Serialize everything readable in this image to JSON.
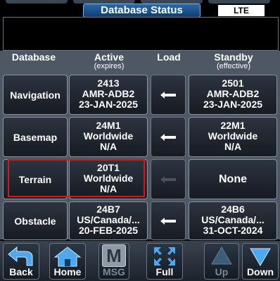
{
  "header": {
    "title": "Database Status",
    "connection": "LTE"
  },
  "columns": {
    "database": "Database",
    "active": "Active",
    "active_sub": "(expires)",
    "load": "Load",
    "standby": "Standby",
    "standby_sub": "(effective)"
  },
  "rows": [
    {
      "name": "Navigation",
      "active": [
        "2413",
        "AMR-ADB2",
        "23-JAN-2025"
      ],
      "standby": [
        "2501",
        "AMR-ADB2",
        "23-JAN-2025"
      ],
      "load_enabled": true
    },
    {
      "name": "Basemap",
      "active": [
        "24M1",
        "Worldwide",
        "N/A"
      ],
      "standby": [
        "22M1",
        "Worldwide",
        "N/A"
      ],
      "load_enabled": true
    },
    {
      "name": "Terrain",
      "active": [
        "20T1",
        "Worldwide",
        "N/A"
      ],
      "standby": [
        "None"
      ],
      "load_enabled": false,
      "highlighted": true
    },
    {
      "name": "Obstacle",
      "active": [
        "24B7",
        "US/Canada/...",
        "20-FEB-2025"
      ],
      "standby": [
        "24B6",
        "US/Canada/...",
        "31-OCT-2024"
      ],
      "load_enabled": true
    }
  ],
  "softkeys": {
    "back": "Back",
    "home": "Home",
    "msg": "MSG",
    "msg_icon_letter": "M",
    "full": "Full",
    "up": "Up",
    "down": "Down"
  },
  "icons": [
    "back-arrow-icon",
    "home-icon",
    "msg-icon",
    "full-screen-icon",
    "up-arrow-icon",
    "down-arrow-icon",
    "load-arrow-icon"
  ],
  "colors": {
    "highlight": "#d21a1a",
    "title_bar": "#1f5a96",
    "accent": "#5aaef0"
  }
}
